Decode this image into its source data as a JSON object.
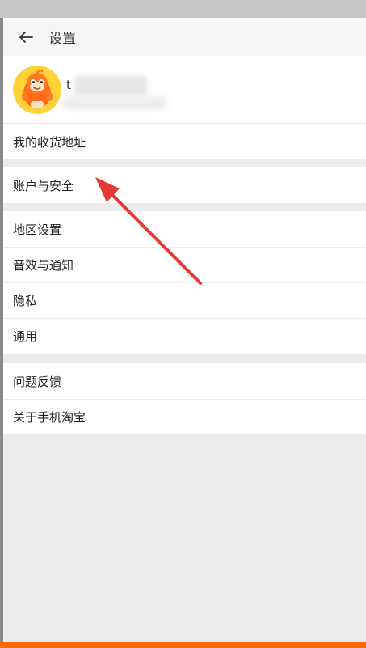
{
  "header": {
    "title": "设置"
  },
  "profile": {
    "name_visible": "t"
  },
  "menu": {
    "group1": [
      {
        "label": "我的收货地址"
      }
    ],
    "group2": [
      {
        "label": "账户与安全"
      }
    ],
    "group3": [
      {
        "label": "地区设置"
      },
      {
        "label": "音效与通知"
      },
      {
        "label": "隐私"
      },
      {
        "label": "通用"
      }
    ],
    "group4": [
      {
        "label": "问题反馈"
      },
      {
        "label": "关于手机淘宝"
      }
    ]
  },
  "colors": {
    "accent": "#ff6a00",
    "annotation_arrow": "#e53935",
    "background": "#ececec"
  },
  "icons": {
    "back": "back-arrow-icon",
    "avatar": "taobao-mascot-avatar"
  }
}
